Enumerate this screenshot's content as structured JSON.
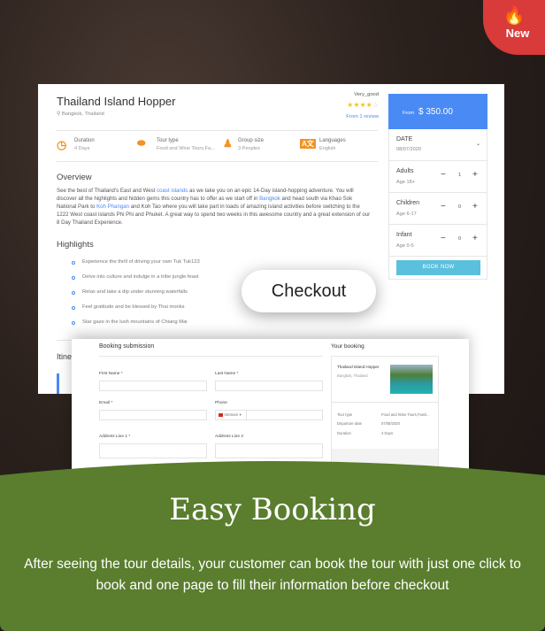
{
  "badge": {
    "label": "New",
    "icon": "flame-icon",
    "color": "#d93a3a"
  },
  "tour": {
    "title": "Thailand Island Hopper",
    "location": "Bangkok, Thailand",
    "rating_label": "Very_good",
    "rating": 4,
    "rating_max": 5,
    "reviews": "From 1 review",
    "info": [
      {
        "label": "Duration",
        "value": "4 Days",
        "icon": "clock-icon"
      },
      {
        "label": "Tour type",
        "value": "Food and Wine Tours,Fa...",
        "icon": "footprints-icon"
      },
      {
        "label": "Group size",
        "value": "3 Peoples",
        "icon": "person-icon"
      },
      {
        "label": "Languages",
        "value": "English",
        "icon": "language-icon"
      }
    ],
    "overview_heading": "Overview",
    "overview": {
      "p1": "See the best of Thailand's East and West ",
      "l1": "coast islands",
      "p2": " as we take you on an epic 14-Day island-hopping adventure. You will discover all the highlights and hidden gems this country has to offer as we start off in ",
      "l2": "Bangkok",
      "p3": " and head south via Khao Sok National Park to ",
      "l3": "Koh Phangan",
      "p4": " and Koh Tao where you will take part in loads of amazing island activities before switching to the 1222 West coast islands Phi Phi and Phuket. A great way to spend two weeks in this awesome country and a great extension of our 8 Day Thailand Experience."
    },
    "highlights_heading": "Highlights",
    "highlights": [
      "Experience the thrill of driving your own Tuk Tuk123",
      "Delve into culture and indulge in a tribe jungle feast",
      "Relax and take a dip under stunning waterfalls",
      "Feel gratitude and be blessed by Thai monks",
      "Star gaze in the lush mountains of Chiang Mai"
    ],
    "itinerary_heading": "Itine"
  },
  "booking": {
    "from": "From",
    "price": "$ 350.00",
    "accent": "#4a8af4",
    "date_label": "DATE",
    "date": "08/07/2020",
    "guests": [
      {
        "label": "Adults",
        "age": "Age 18+",
        "count": "1"
      },
      {
        "label": "Children",
        "age": "Age 6-17",
        "count": "0"
      },
      {
        "label": "Infant",
        "age": "Age 0-5",
        "count": "0"
      }
    ],
    "minus": "−",
    "plus": "+",
    "book_now": "BOOK NOW"
  },
  "checkout": "Checkout",
  "submission": {
    "heading": "Booking submission",
    "first_name": "First Name *",
    "last_name": "Last Name *",
    "email": "Email *",
    "phone": "Phone",
    "country": "Vietnam",
    "address1": "Address Line 1 *",
    "address2": "Address Line 2"
  },
  "your_booking": {
    "heading": "Your booking",
    "title": "Thailand Island Hopper",
    "location": "Bangkok, Thailand",
    "rows": [
      {
        "k": "Tour type",
        "v": "Food and Wine Tours,Famil..."
      },
      {
        "k": "Departure date",
        "v": "07/08/2020"
      },
      {
        "k": "Duration",
        "v": "4 Days"
      }
    ]
  },
  "footer": {
    "title": "Easy Booking",
    "description": "After seeing the tour details, your customer can book the tour with just one click to book and one page to fill their information before checkout",
    "color": "#5a7d2e"
  }
}
